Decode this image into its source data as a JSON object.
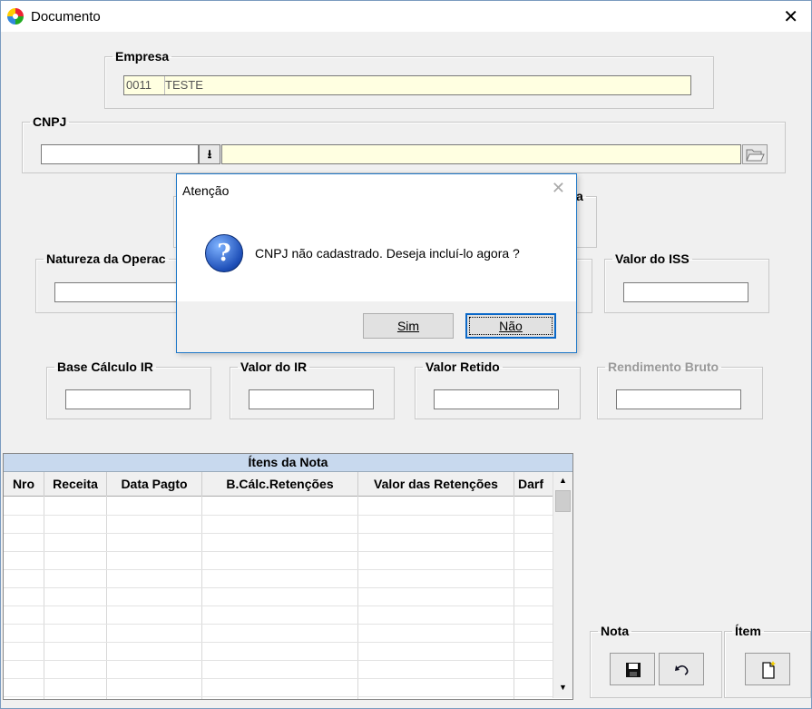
{
  "window": {
    "title": "Documento"
  },
  "empresa": {
    "label": "Empresa",
    "code": "0011",
    "name": "TESTE"
  },
  "cnpj": {
    "label": "CNPJ",
    "value": "",
    "name": ""
  },
  "groups": {
    "natureza": "Natureza da Operac",
    "valor_iss": "Valor do ISS",
    "base_ir": "Base Cálculo IR",
    "valor_ir": "Valor do IR",
    "valor_retido": "Valor Retido",
    "rendimento_bruto": "Rendimento Bruto",
    "hidden_partial": "a"
  },
  "dialog": {
    "title": "Atenção",
    "message": "CNPJ não cadastrado. Deseja incluí-lo agora ?",
    "yes_label": "Sim",
    "no_label": "Não"
  },
  "grid": {
    "caption": "Ítens da Nota",
    "columns": [
      "Nro",
      "Receita",
      "Data Pagto",
      "B.Cálc.Retenções",
      "Valor das Retenções",
      "Darf"
    ]
  },
  "nota": {
    "label": "Nota"
  },
  "item": {
    "label": "Ítem"
  }
}
